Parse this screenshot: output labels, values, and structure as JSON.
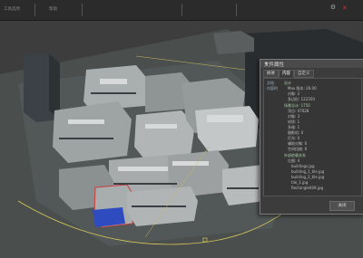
{
  "toolbar": {
    "label_left": "工具选项",
    "label_mid": "帮助"
  },
  "dialog": {
    "title": "文件属性",
    "tabs": [
      "摘要",
      "内容",
      "自定义"
    ],
    "rows": [
      "文档",
      "内容时",
      "总计",
      "Max 版本: 26.00",
      "对象: 2",
      "多边形: 122350",
      "场景总计: 1750",
      "顶点: 47028",
      "对象: 3",
      "材质: 1",
      "多维: 1",
      "摄影机: 0",
      "灯光: 0",
      "辅助对象: 0",
      "空间扭曲: 0",
      "外部依赖关系",
      "位图: 4",
      "buildings.jpg",
      "building_1_tile.jpg",
      "building_2_tile.jpg",
      "tile_1.jpg",
      "Rectangle009.jpg"
    ],
    "close_icon": "✕",
    "button_close": "关闭"
  },
  "colors": {
    "background": "#3d3d3d",
    "ground": "#555a59",
    "building": "#a8adae",
    "selection": "#c83c3c",
    "accent_blue": "#2e4cbf",
    "path": "#d8c85a"
  }
}
